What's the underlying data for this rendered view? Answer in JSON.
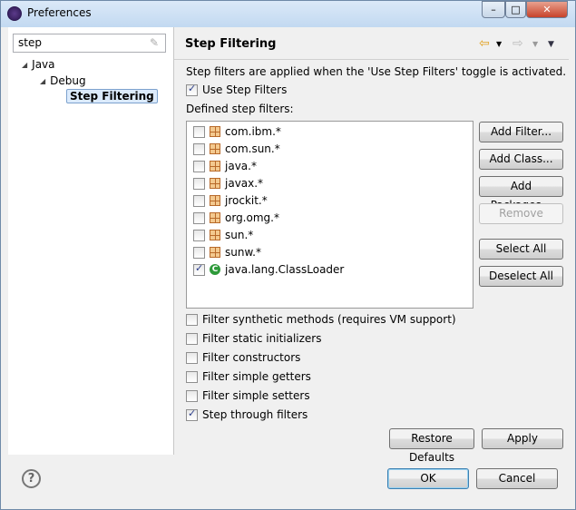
{
  "window": {
    "title": "Preferences",
    "minimize": "–",
    "maximize": "□",
    "close": "✕"
  },
  "search": {
    "value": "step"
  },
  "tree": [
    {
      "label": "Java"
    },
    {
      "label": "Debug"
    },
    {
      "label": "Step Filtering",
      "selected": true
    }
  ],
  "page": {
    "title": "Step Filtering",
    "description": "Step filters are applied when the 'Use Step Filters' toggle is activated.",
    "use_step_filters": {
      "label": "Use Step Filters",
      "checked": true
    },
    "defined_label": "Defined step filters:",
    "filters": [
      {
        "label": "com.ibm.*",
        "checked": false,
        "icon": "package-icon"
      },
      {
        "label": "com.sun.*",
        "checked": false,
        "icon": "package-icon"
      },
      {
        "label": "java.*",
        "checked": false,
        "icon": "package-icon"
      },
      {
        "label": "javax.*",
        "checked": false,
        "icon": "package-icon"
      },
      {
        "label": "jrockit.*",
        "checked": false,
        "icon": "package-icon"
      },
      {
        "label": "org.omg.*",
        "checked": false,
        "icon": "package-icon"
      },
      {
        "label": "sun.*",
        "checked": false,
        "icon": "package-icon"
      },
      {
        "label": "sunw.*",
        "checked": false,
        "icon": "package-icon"
      },
      {
        "label": "java.lang.ClassLoader",
        "checked": true,
        "icon": "class-icon"
      }
    ],
    "buttons": {
      "add_filter": "Add Filter...",
      "add_class": "Add Class...",
      "add_packages": "Add Packages...",
      "remove": "Remove",
      "select_all": "Select All",
      "deselect_all": "Deselect All"
    },
    "options": [
      {
        "label": "Filter synthetic methods (requires VM support)",
        "checked": false
      },
      {
        "label": "Filter static initializers",
        "checked": false
      },
      {
        "label": "Filter constructors",
        "checked": false
      },
      {
        "label": "Filter simple getters",
        "checked": false
      },
      {
        "label": "Filter simple setters",
        "checked": false
      },
      {
        "label": "Step through filters",
        "checked": true
      }
    ],
    "restore_defaults": "Restore Defaults",
    "apply": "Apply"
  },
  "footer": {
    "help": "?",
    "ok": "OK",
    "cancel": "Cancel"
  }
}
